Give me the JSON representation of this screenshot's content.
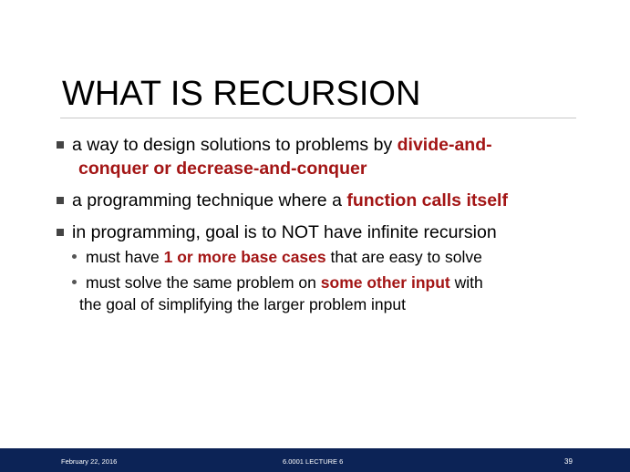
{
  "slide": {
    "title": "WHAT IS RECURSION",
    "bullets": [
      {
        "parts": [
          "a way to design solutions to problems by ",
          "divide-and-",
          "conquer or decrease-and-conquer"
        ]
      },
      {
        "parts": [
          "a programming technique where a ",
          "function calls itself"
        ]
      },
      {
        "parts": [
          "in programming, goal is to NOT have infinite recursion"
        ],
        "sub": [
          {
            "parts": [
              "must have ",
              "1 or more base cases",
              " that are easy to solve"
            ]
          },
          {
            "parts": [
              "must solve the same problem on ",
              "some other input",
              " with",
              "the goal of simplifying the larger problem input"
            ]
          }
        ]
      }
    ]
  },
  "footer": {
    "date": "February 22, 2016",
    "course": "6.0001 LECTURE 6",
    "page": "39"
  },
  "colors": {
    "highlight": "#a31515",
    "footer_bg": "#0c2356"
  }
}
